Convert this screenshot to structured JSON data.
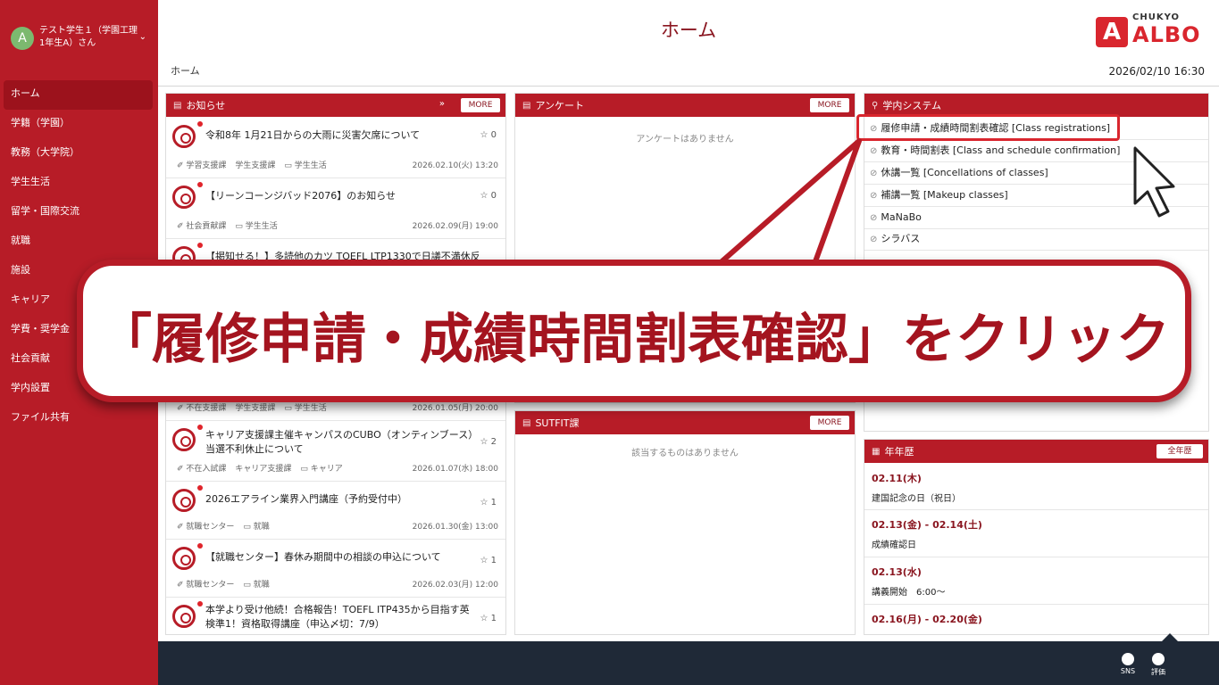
{
  "user": {
    "avatar_letter": "A",
    "name": "テスト学生１（学園工理 1年生A）さん"
  },
  "sidebar": {
    "items": [
      {
        "label": "ホーム"
      },
      {
        "label": "学籍（学園）"
      },
      {
        "label": "教務（大学院）"
      },
      {
        "label": "学生生活"
      },
      {
        "label": "留学・国際交流"
      },
      {
        "label": "就職"
      },
      {
        "label": "施設"
      },
      {
        "label": "キャリア"
      },
      {
        "label": "学費・奨学金"
      },
      {
        "label": "社会貢献"
      },
      {
        "label": "学内設置"
      },
      {
        "label": "ファイル共有"
      }
    ]
  },
  "header": {
    "title": "ホーム",
    "breadcrumb": "ホーム",
    "datetime": "2026/02/10 16:30",
    "logo_small": "CHUKYO",
    "logo_big": "ALBO",
    "logo_letter": "A"
  },
  "news": {
    "title": "お知らせ",
    "more": "MORE",
    "items": [
      {
        "title": "令和8年 1月21日からの大雨に災害欠席について",
        "stars": "☆ 0",
        "cat1": "✐ 学習支援課",
        "cat2": "学生支援課",
        "cat3": "▭ 学生生活",
        "date": "2026.02.10(火) 13:20"
      },
      {
        "title": "【リーンコーンジバッド2076】のお知らせ",
        "stars": "☆ 0",
        "cat1": "✐ 社会貢献課",
        "cat2": "▭ 学生生活",
        "cat3": "",
        "date": "2026.02.09(月) 19:00"
      },
      {
        "title": "【掲知せる！】多読他のカツ TOEFL LTP1330で日議不満休反",
        "stars": "",
        "cat1": "",
        "cat2": "",
        "cat3": "",
        "date": ""
      },
      {
        "title": "",
        "stars": "",
        "cat1": "✐ 不在支援課",
        "cat2": "学生支援課",
        "cat3": "▭ 学生生活",
        "date": "2026.01.05(月) 20:00"
      },
      {
        "title": "キャリア支援課主催キャンパスのCUBO（オンティンブース）当選不利休止について",
        "stars": "☆ 2",
        "cat1": "✐ 不在入試課",
        "cat2": "キャリア支援課",
        "cat3": "▭ キャリア",
        "date": "2026.01.07(水) 18:00"
      },
      {
        "title": "2026エアライン業界入門講座（予約受付中）",
        "stars": "☆ 1",
        "cat1": "✐ 就職センター",
        "cat2": "▭ 就職",
        "cat3": "",
        "date": "2026.01.30(金) 13:00"
      },
      {
        "title": "【就職センター】春休み期間中の相談の申込について",
        "stars": "☆ 1",
        "cat1": "✐ 就職センター",
        "cat2": "▭ 就職",
        "cat3": "",
        "date": "2026.02.03(月) 12:00"
      },
      {
        "title": "本学より受け他続！合格報告！TOEFL ITP435から目指す英検準1！資格取得講座（申込〆切：7/9）",
        "stars": "☆ 1",
        "cat1": "",
        "cat2": "",
        "cat3": "",
        "date": ""
      }
    ]
  },
  "survey": {
    "title": "アンケート",
    "more": "MORE",
    "empty": "アンケートはありません"
  },
  "submit": {
    "title": "SUTFIT課",
    "more": "MORE",
    "empty": "該当するものはありません"
  },
  "system": {
    "title": "学内システム",
    "items": [
      {
        "label": "履修申請・成績時間割表確認 [Class registrations]"
      },
      {
        "label": "教育・時間割表 [Class and schedule confirmation]"
      },
      {
        "label": "休講一覧 [Concellations of classes]"
      },
      {
        "label": "補講一覧 [Makeup classes]"
      },
      {
        "label": "MaNaBo"
      },
      {
        "label": "シラバス"
      }
    ]
  },
  "calendar": {
    "title": "年年歴",
    "button": "全年歴",
    "items": [
      {
        "date": "02.11(木)",
        "text": "建国記念の日（祝日）"
      },
      {
        "date": "02.13(金) - 02.14(土)",
        "text": "成績確認日"
      },
      {
        "date": "02.13(水)",
        "text": "講義開始　6:00〜"
      },
      {
        "date": "02.16(月) - 02.20(金)",
        "text": ""
      }
    ]
  },
  "footer": {
    "btn1": "SNS",
    "btn2": "評価"
  },
  "callout": {
    "text": "「履修申請・成績時間割表確認」をクリック"
  }
}
